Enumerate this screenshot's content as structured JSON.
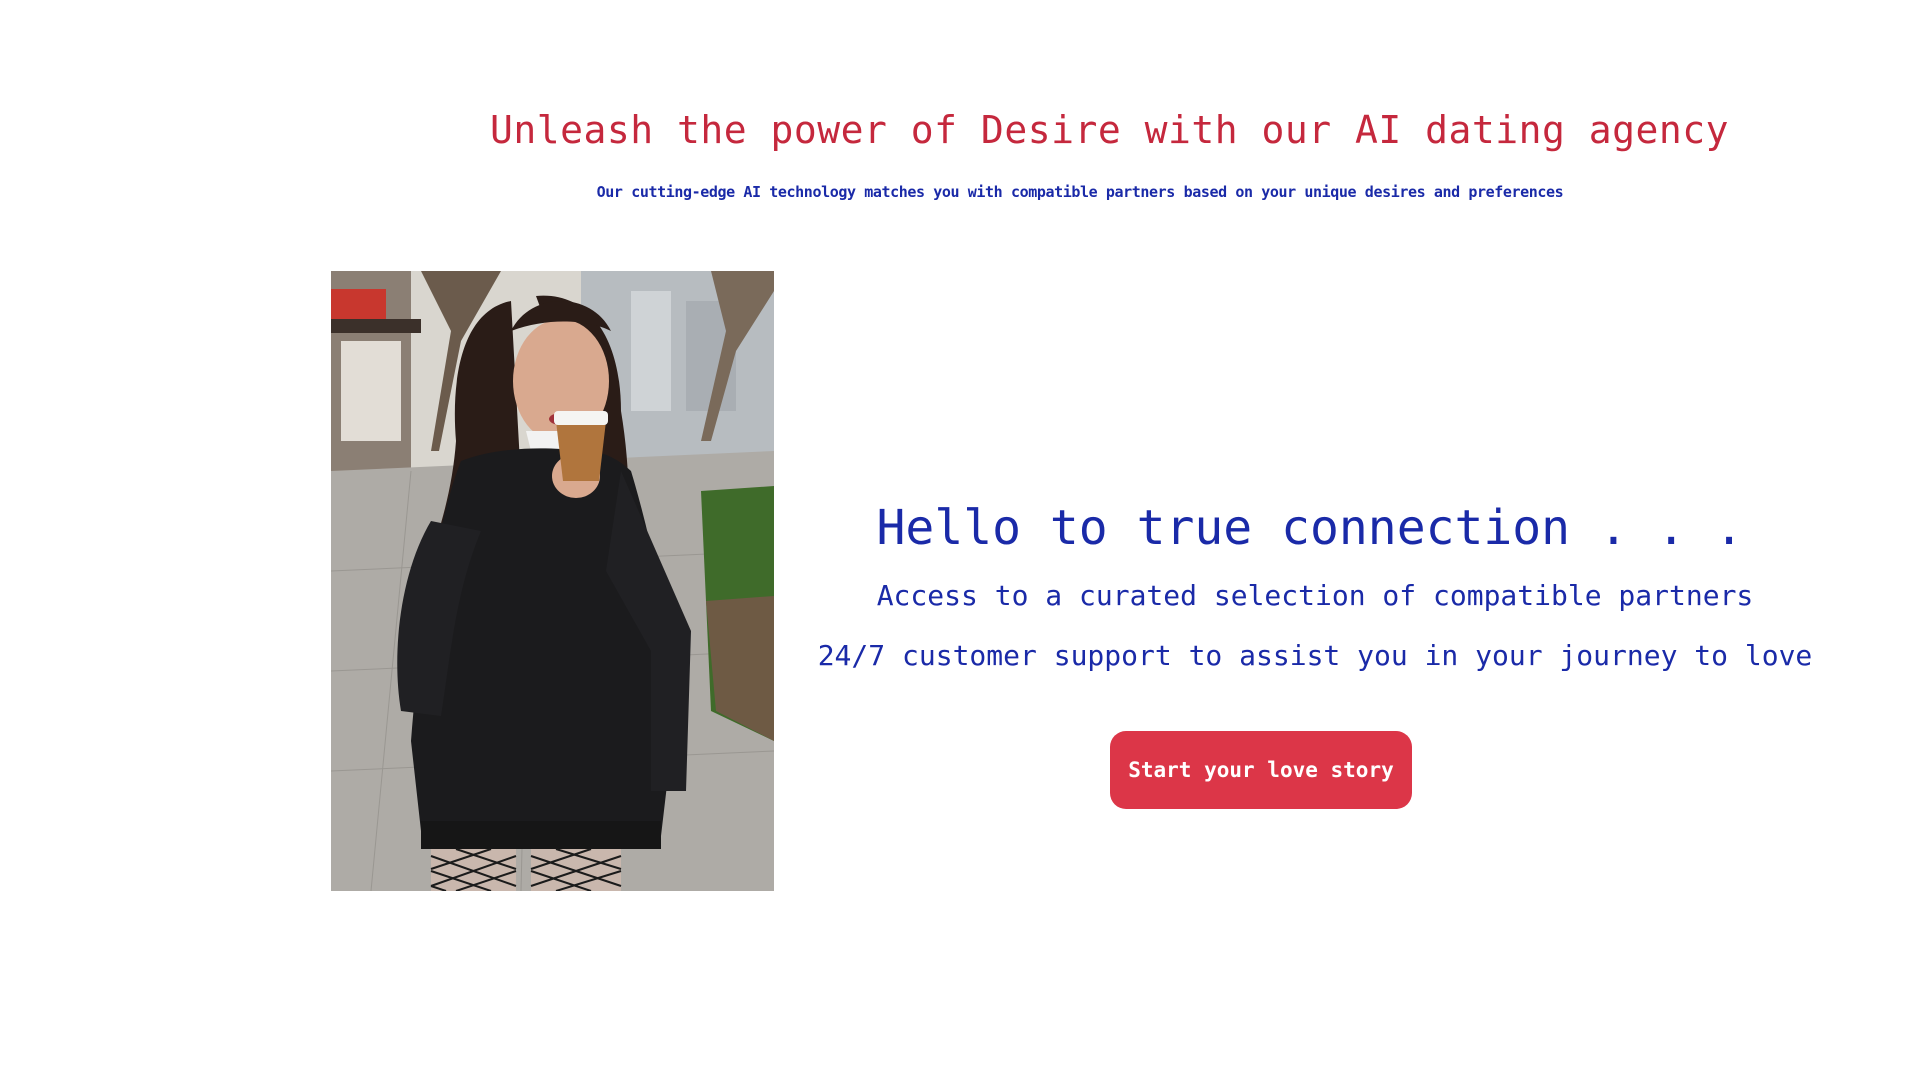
{
  "hero": {
    "title": "Unleash the power of Desire with our AI dating agency",
    "subtitle": "Our cutting-edge AI technology matches you with compatible partners based on your unique desires and preferences"
  },
  "photo": {
    "alt": "Woman in black sweater holding a coffee cup"
  },
  "content": {
    "heading": "Hello to true connection . . .",
    "features": [
      "Access to a curated selection of compatible partners",
      "24/7 customer support to assist you in your journey to love"
    ],
    "cta_label": "Start your love story"
  },
  "colors": {
    "title_red": "#c5283d",
    "text_blue": "#1a2aa8",
    "button_red": "#dc3648",
    "background": "#ffffff"
  }
}
